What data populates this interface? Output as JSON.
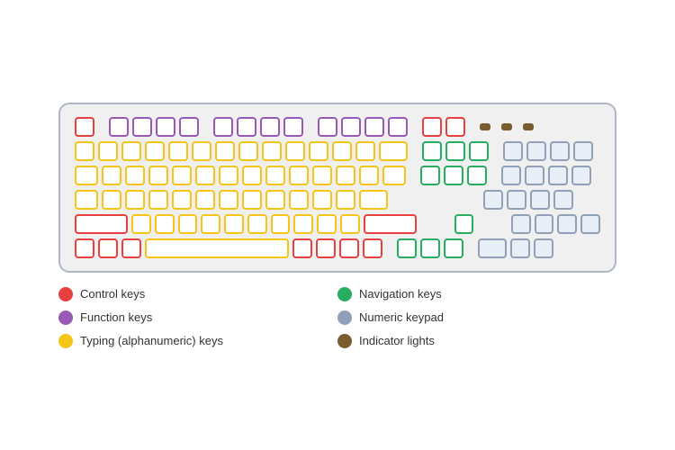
{
  "legend": {
    "left": [
      {
        "id": "control",
        "label": "Control keys",
        "color": "dot-red"
      },
      {
        "id": "function",
        "label": "Function keys",
        "color": "dot-purple"
      },
      {
        "id": "typing",
        "label": "Typing (alphanumeric) keys",
        "color": "dot-yellow"
      }
    ],
    "right": [
      {
        "id": "navigation",
        "label": "Navigation keys",
        "color": "dot-green"
      },
      {
        "id": "numpad",
        "label": "Numeric keypad",
        "color": "dot-bluegray"
      },
      {
        "id": "indicator",
        "label": "Indicator lights",
        "color": "dot-brown"
      }
    ]
  }
}
